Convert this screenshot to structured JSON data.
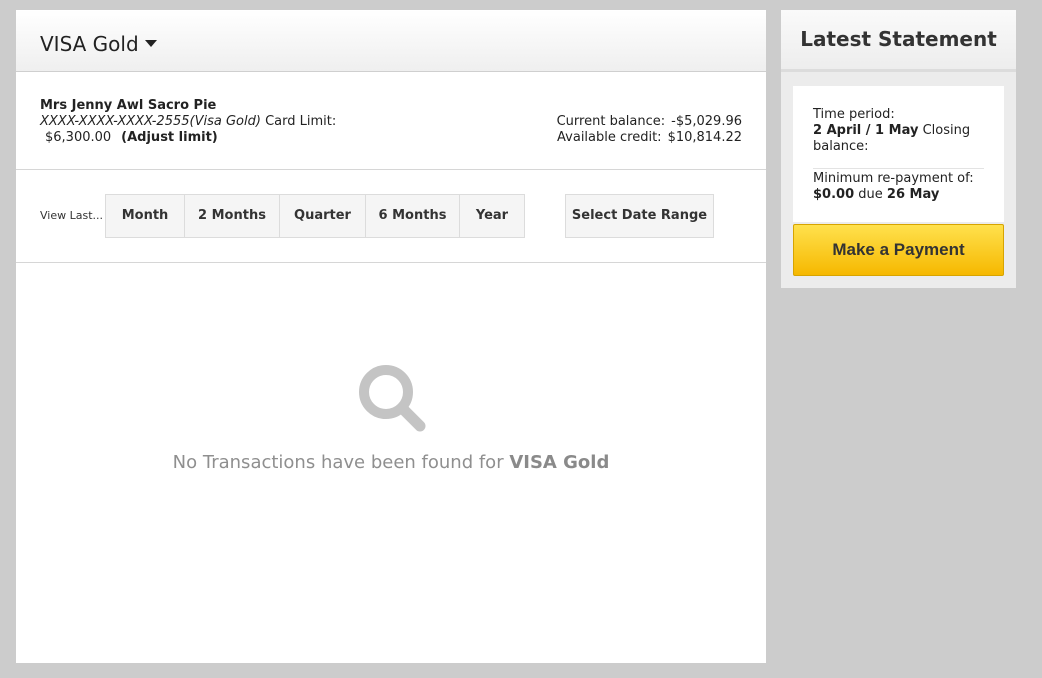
{
  "card": {
    "title": "VISA Gold"
  },
  "account": {
    "holder": "Mrs Jenny Awl Sacro Pie",
    "number": "XXXX-XXXX-XXXX-2555",
    "card_type": "(Visa Gold)",
    "limit_label": "Card Limit:",
    "limit_value": "$6,300.00",
    "adjust_link": "(Adjust limit)",
    "current_balance_label": "Current balance:",
    "current_balance_value": "-$5,029.96",
    "available_credit_label": "Available credit:",
    "available_credit_value": "$10,814.22"
  },
  "filters": {
    "view_last_label": "View Last...",
    "periods": [
      "Month",
      "2 Months",
      "Quarter",
      "6 Months",
      "Year"
    ],
    "date_range_label": "Select Date Range"
  },
  "empty_state": {
    "icon": "magnifier-icon",
    "message_prefix": "No Transactions have been found for",
    "message_account": "VISA Gold"
  },
  "statement": {
    "title": "Latest Statement",
    "time_period_label": "Time period:",
    "time_period_value": "2 April / 1 May",
    "closing_balance_label": "Closing balance:",
    "min_repayment_label": "Minimum re-payment of:",
    "min_repayment_value": "$0.00",
    "due_label": "due",
    "due_date": "26 May",
    "pay_button": "Make a Payment"
  },
  "colors": {
    "background": "#cccccc",
    "pay_button_top": "#ffe14d",
    "pay_button_bottom": "#f6b800",
    "empty_icon": "#c4c4c4"
  }
}
